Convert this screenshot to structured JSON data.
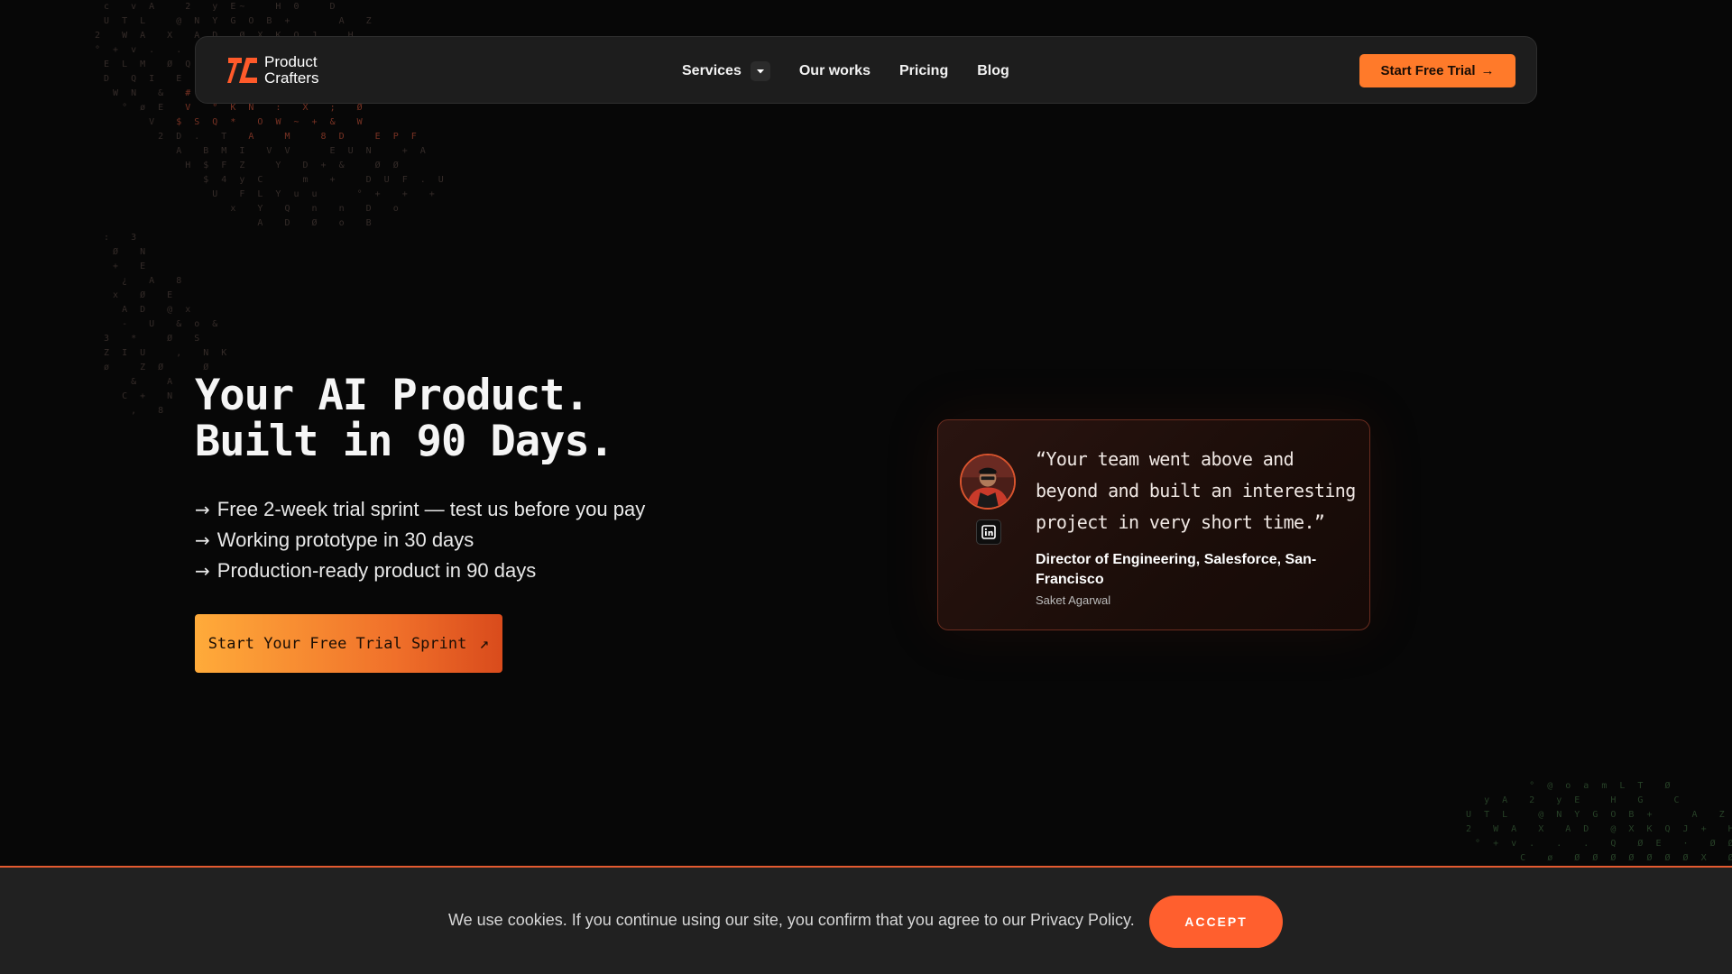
{
  "brand": {
    "name_line1": "Product",
    "name_line2": "Crafters",
    "accent": "#ff7a2a",
    "accent_dark": "#e35a30"
  },
  "nav": {
    "items": [
      {
        "label": "Services",
        "has_dropdown": true
      },
      {
        "label": "Our works"
      },
      {
        "label": "Pricing"
      },
      {
        "label": "Blog"
      }
    ],
    "cta_label": "Start Free Trial",
    "cta_arrow": "→"
  },
  "hero": {
    "title_line1": "Your AI Product.",
    "title_line2": "Built in 90 Days.",
    "bullets": [
      "Free 2-week trial sprint — test us before you pay",
      "Working prototype in 30 days",
      "Production-ready product in 90 days"
    ],
    "bullet_arrow": "→",
    "cta_label": "Start Your Free Trial Sprint",
    "cta_arrow": "↗"
  },
  "testimonial": {
    "quote": "“Your team went above and beyond and built an interesting project in very short time.”",
    "role": "Director of Engineering, Salesforce, San-Francisco",
    "name": "Saket Agarwal",
    "social_icon": "linkedin-icon"
  },
  "cookie": {
    "text": "We use cookies. If you continue using our site, you confirm that you agree to our Privacy Policy.",
    "accept_label": "ACCEPT"
  }
}
